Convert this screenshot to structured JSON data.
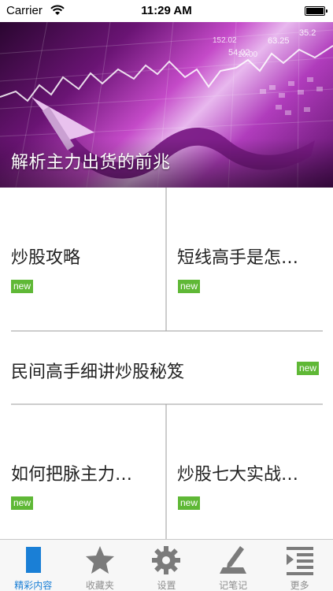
{
  "status_bar": {
    "carrier": "Carrier",
    "time": "11:29 AM"
  },
  "banner": {
    "caption": "解析主力出货的前兆",
    "chart_numbers": [
      "10.00",
      "152.02",
      "54.02",
      "63.25",
      "35.2"
    ]
  },
  "cards": [
    {
      "title": "炒股攻略",
      "badge": "new"
    },
    {
      "title": "短线高手是怎…",
      "badge": "new"
    },
    {
      "title": "民间高手细讲炒股秘笈",
      "badge": "new"
    },
    {
      "title": "如何把脉主力…",
      "badge": "new"
    },
    {
      "title": "炒股七大实战…",
      "badge": "new"
    }
  ],
  "tab_bar": {
    "tabs": [
      {
        "label": "精彩内容",
        "icon": "document-icon",
        "active": true
      },
      {
        "label": "收藏夹",
        "icon": "star-icon",
        "active": false
      },
      {
        "label": "设置",
        "icon": "gear-icon",
        "active": false
      },
      {
        "label": "记笔记",
        "icon": "pen-note-icon",
        "active": false
      },
      {
        "label": "更多",
        "icon": "list-more-icon",
        "active": false
      }
    ]
  },
  "colors": {
    "accent": "#1a7fd6",
    "badge": "#5fb836",
    "inactive_tab": "#8e8e8e"
  }
}
